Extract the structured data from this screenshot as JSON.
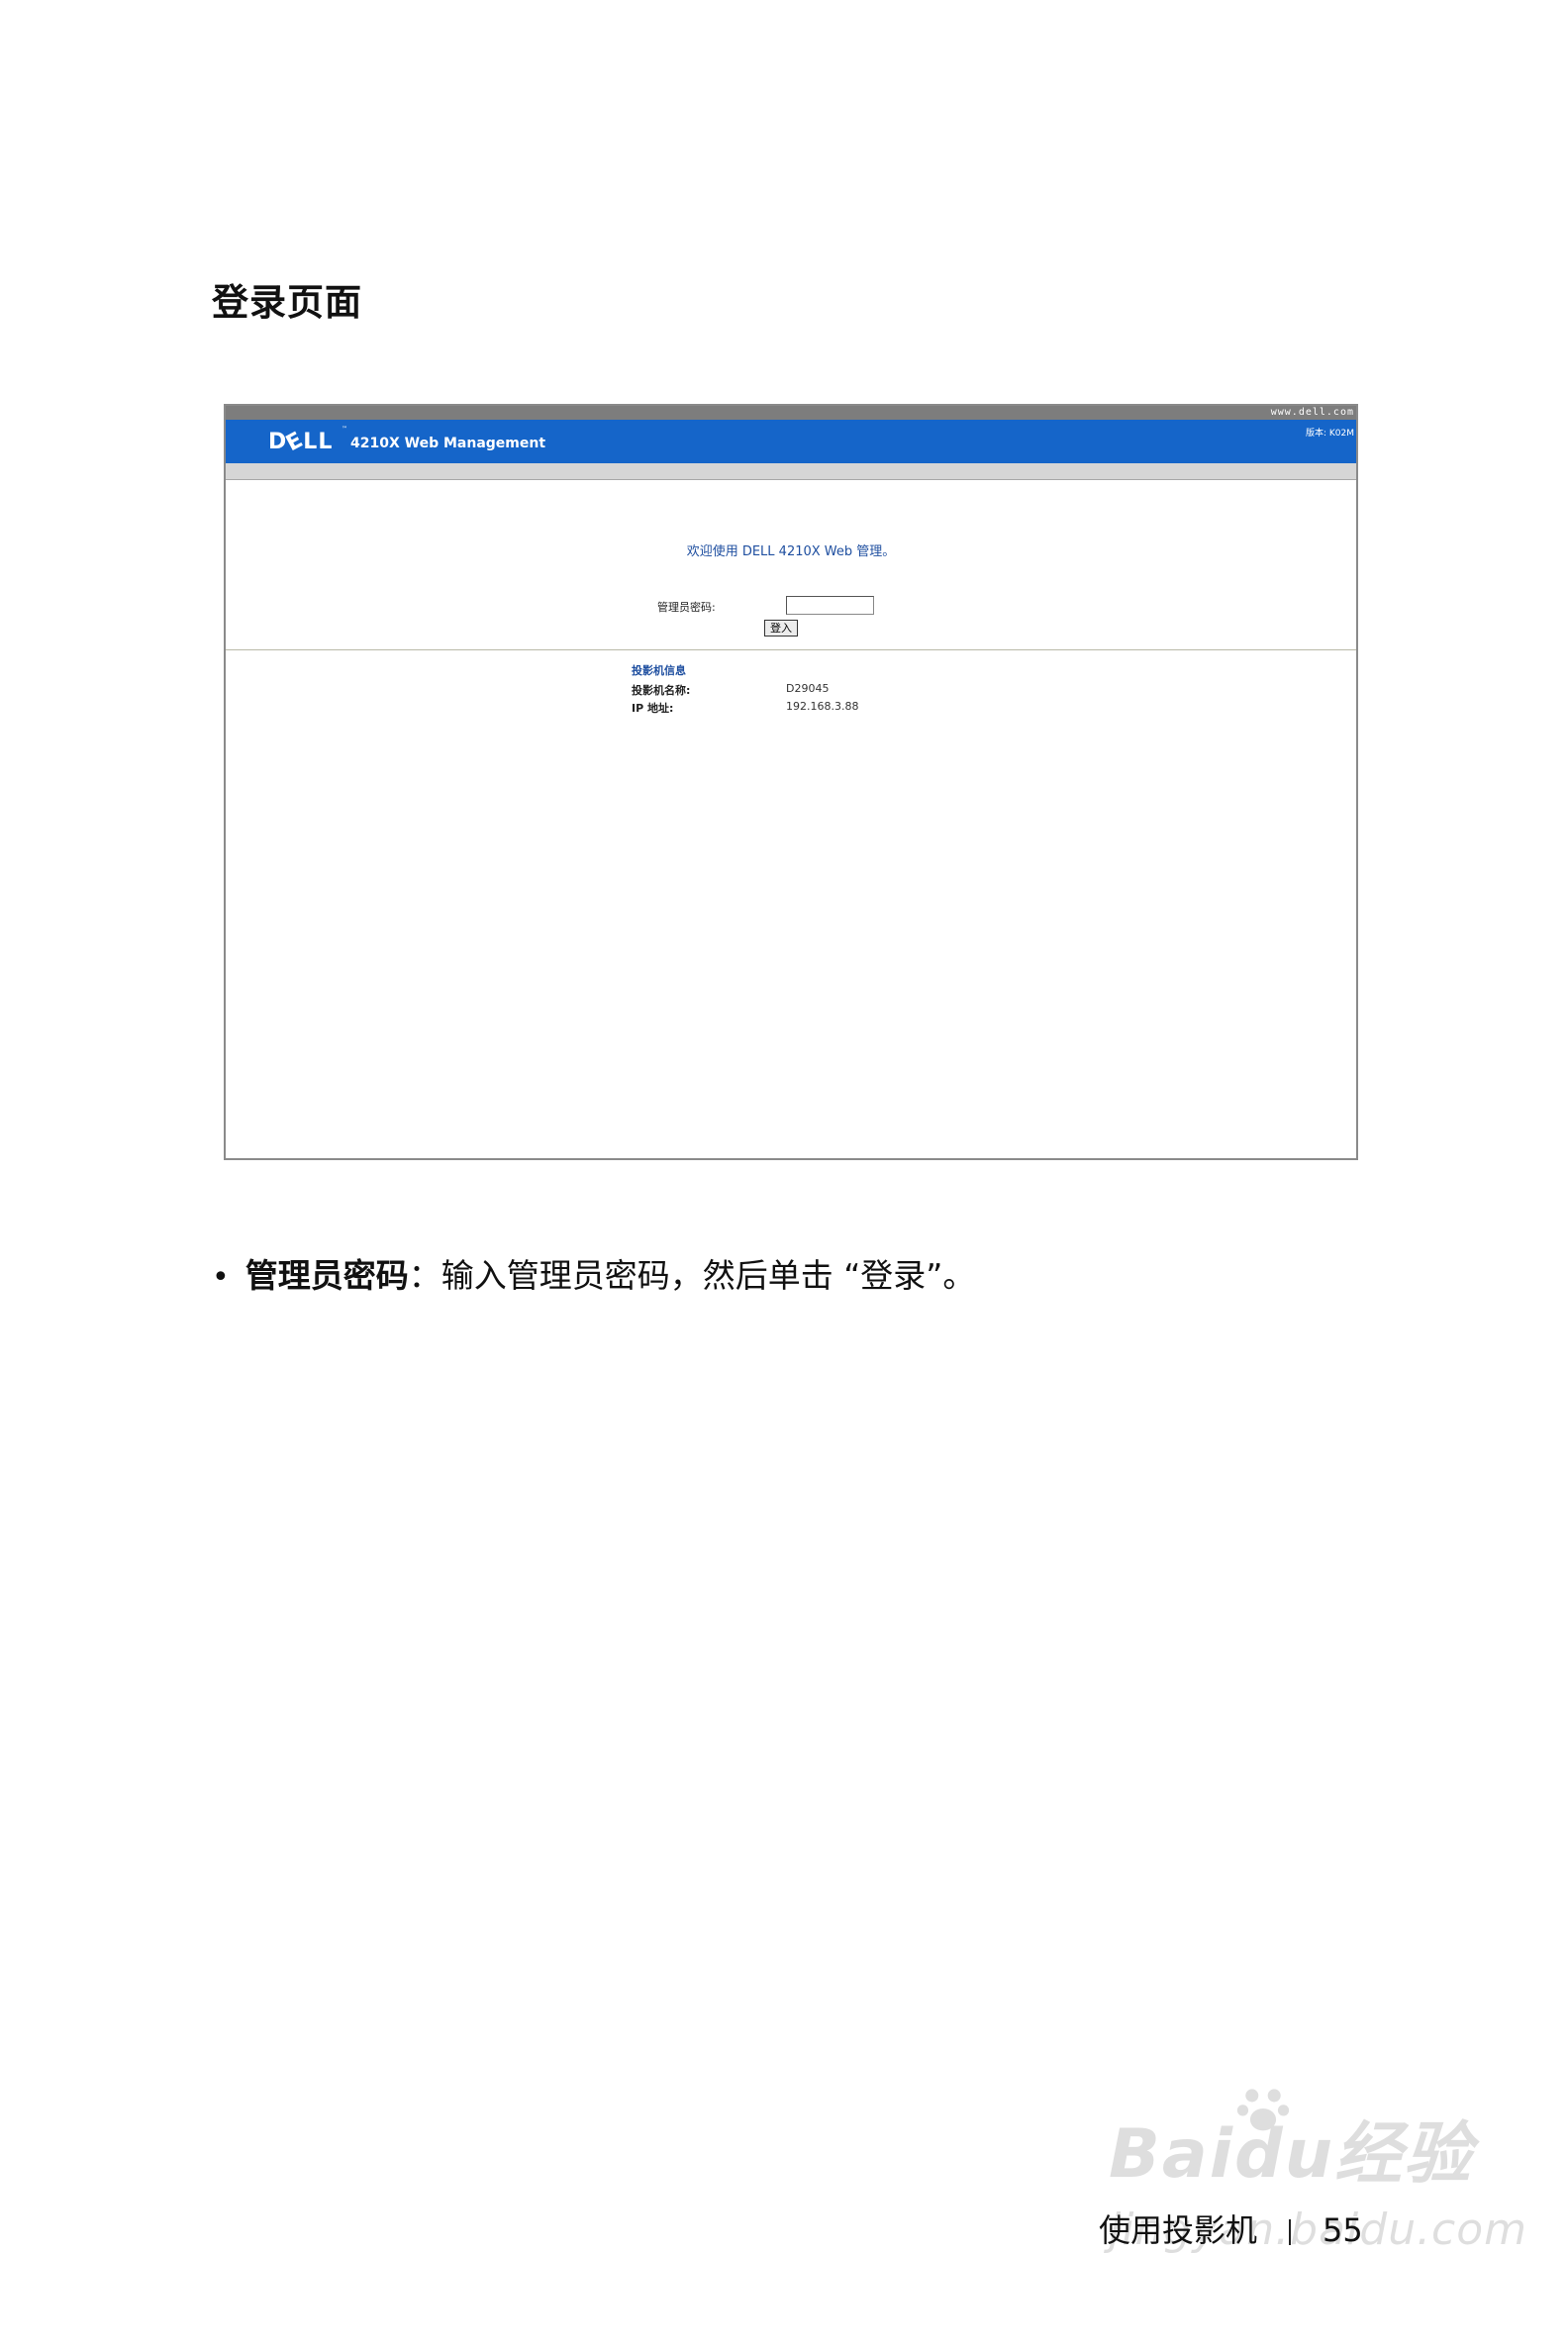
{
  "page": {
    "heading": "登录页面",
    "bullet": {
      "term": "管理员密码",
      "text": "：输入管理员密码，然后单击 “登录”。"
    },
    "footer": {
      "section": "使用投影机",
      "page_number": "55"
    },
    "watermark": {
      "brand": "Baidu经验",
      "url": "jingyan.baidu.com"
    }
  },
  "screenshot": {
    "topbar_url": "www.dell.com",
    "brand_logo": "DELL",
    "product_title": "4210X Web Management",
    "version_text": "版本: K02M",
    "welcome": "欢迎使用  DELL 4210X Web 管理。",
    "password_label": "管理员密码:",
    "password_value": "",
    "login_button": "登入",
    "info": {
      "title": "投影机信息",
      "name_label": "投影机名称:",
      "name_value": "D29045",
      "ip_label": "IP 地址:",
      "ip_value": "192.168.3.88"
    },
    "colors": {
      "banner": "#1565c9",
      "topbar": "#7d7d7d",
      "accent_text": "#1f4fa0"
    }
  }
}
